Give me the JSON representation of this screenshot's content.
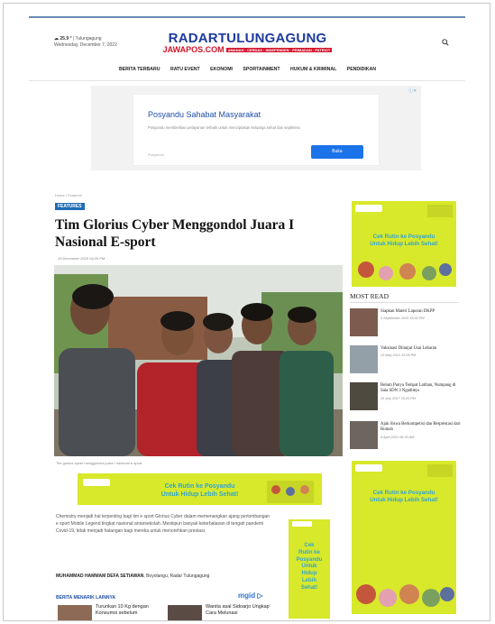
{
  "header": {
    "weather": "☁ 25.9 °",
    "city": "Tulungagung",
    "date": "Wednesday, December 7, 2022",
    "logo_main": "RADARTULUNGAGUNG",
    "logo_sub": "JAWAPOS.COM",
    "logo_tag": "AMANAH · CERDAS · INDEPENDEN · PRIMADAN · PATRIOT"
  },
  "nav": [
    "BERITA TERBARU",
    "RATU EVENT",
    "EKONOMI",
    "SPORTAINMENT",
    "HUKUM & KRIMINAL",
    "PENDIDIKAN"
  ],
  "top_ad": {
    "title": "Posyandu Sahabat Masyarakat",
    "desc": "Posyandu memberikan pelayanan terbaik untuk menciptakan keluarga sehat dan sejahtera.",
    "source": "Posyandu",
    "button": "Buka"
  },
  "article": {
    "breadcrumb": "Home / Features",
    "category": "FEATURES",
    "title": "Tim Glorius Cyber Menggondol Juara I Nasional E-sport",
    "date": "29 December 2020 04:29 PM",
    "caption": "Tim glorius cyber menggondol juara I nasional e-sport.",
    "paragraph": "Chemistry menjadi hal terpenting bagi tim e sport Glorius Cyber dalam memenangkan ajang perlombangan e sport Mobile Legend tingkat nasional antarsekolah. Meskipun banyak keterbatasan di tengah pandemi Covid-19, tidak menjadi halangan bagi mereka untuk menorehkan prestasi.",
    "author_name": "MUHAMMAD HAMMAM DEFA SETIAWAN",
    "author_rest": ", Boyolangu, Radar Tulungagung"
  },
  "ads": {
    "posyandu_line1": "Cek Rutin ke Posyandu",
    "posyandu_line2": "Untuk Hidup Lebih Sehat!",
    "narrow_text": [
      "Cek",
      "Rutin ke",
      "Posyandu",
      "Untuk",
      "Hidup",
      "Lebih",
      "Sehat!"
    ]
  },
  "related": {
    "heading": "BERITA MENARIK LAINNYA",
    "brand": "mgid",
    "items": [
      {
        "title": "Turunkan 10 Kg dengan Konsumsi sebelum"
      },
      {
        "title": "Wanita asal Sidoarjo Ungkap Cara Melunasi"
      }
    ]
  },
  "most_read": {
    "heading": "MOST READ",
    "items": [
      {
        "title": "Siapkan Materi Laporan DKPP",
        "date": "3 September 2020 15:02 PM"
      },
      {
        "title": "Vaksinasi Dilanjut Usai Lebaran",
        "date": "13 May 2021 12:09 PM"
      },
      {
        "title": "Belum Punya Tempat Latihan, Numpang di Sala SDN 3 Ngadirejo",
        "date": "29 July 2017 15:20 PM"
      },
      {
        "title": "Ajak Siswa Berkompetisi dan Berprestasi dari Rumah",
        "date": "9 April 2021 08:30 AM"
      }
    ]
  },
  "colors": {
    "brand_blue": "#1d3a9e",
    "brand_red": "#d3132a",
    "ad_yellow": "#d8e82a",
    "ad_text": "#2fa4d6"
  }
}
